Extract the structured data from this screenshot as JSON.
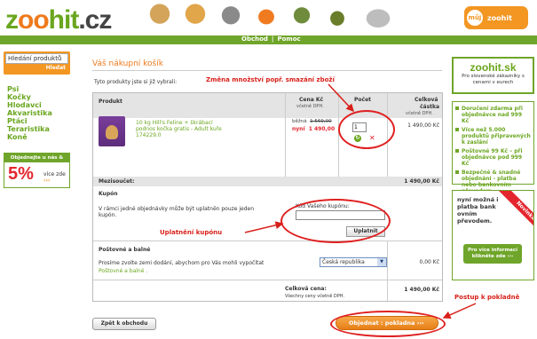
{
  "header": {
    "logo_parts": [
      "z",
      "oo",
      "hit",
      ".cz"
    ],
    "nav": [
      "Obchod",
      "|",
      "Pomoc"
    ],
    "muj_circle": "můj",
    "muj_label": "zoohit"
  },
  "search": {
    "value": "Hledání produktů",
    "button": "Hledat"
  },
  "categories": [
    "Psi",
    "Kočky",
    "Hlodavci",
    "Akvaristika",
    "Ptáci",
    "Teraristika",
    "Koně"
  ],
  "promo": {
    "title": "Objednejte u nás & ušetříte",
    "percent": "5%",
    "more": "více zde"
  },
  "page": {
    "title": "Váš nákupní košík",
    "subtitle": "Tyto produkty jste si již vybrali:"
  },
  "table": {
    "headers": {
      "product": "Produkt",
      "unit_price": "Cena Kč",
      "unit_price_sub": "včetně DPH.",
      "qty": "Počet",
      "total": "Celková",
      "total_2": "částka",
      "total_sub": "včetně DPH."
    },
    "item": {
      "name": "10 kg Hill's Feline + škrábací podnos kočka gratis - Adult kuře",
      "code": "174229.0",
      "old_label": "běžná",
      "old_price": "1 569,00",
      "new_label": "nyní",
      "new_price": "1 490,00",
      "qty": "1",
      "total": "1 490,00 Kč"
    },
    "subtotal_label": "Mezisoučet:",
    "subtotal_value": "1 490,00 Kč",
    "coupon": {
      "title": "Kupón",
      "text": "V rámci jedné objednávky může být uplatněn pouze jeden kupón.",
      "field_label": "Kód Vašeho kupónu:",
      "button": "Uplatnit"
    },
    "shipping": {
      "title": "Poštovné a balné",
      "text": "Prosíme zvolte zemi dodání, abychom pro Vás mohli vypočítat",
      "link": "Poštovné a balné .",
      "country": "Česká republika",
      "price": "0,00 Kč"
    },
    "total": {
      "label": "Celková cena:",
      "note": "Všechny ceny včetně DPH.",
      "value": "1 490,00 Kč"
    }
  },
  "buttons": {
    "back": "Zpět k obchodu",
    "order": "Objednat : pokladna"
  },
  "annotations": {
    "qty": "Změna množství popř. smazání zboží",
    "coupon": "Uplatnění kupónu",
    "checkout": "Postup k pokladně"
  },
  "right": {
    "sk_logo": "zoohit.sk",
    "sk_text": "Pro slovenské zákazníky s cenami v eurech",
    "benefits": [
      "Doručení zdarma při objednávce nad 999 Kč",
      "Více než 5.000 produktů připravených k zaslání",
      "Poštovné 99 Kč – při objednávce pod 999 Kč",
      "Bezpečné & snadné objednání - platba nebo bankovním převodem"
    ],
    "bank_text": "nyní možná i platba bank ovním převodem.",
    "bank_badge": "Novinka",
    "bank_button": "Pro více informací klikněte zde"
  },
  "colors": {
    "brand_green": "#6aa61e",
    "brand_orange": "#f39622",
    "annotation_red": "#d8201a"
  },
  "icons": [
    "refresh-icon",
    "delete-icon",
    "chevron-down-icon",
    "arrow-right-icon"
  ]
}
